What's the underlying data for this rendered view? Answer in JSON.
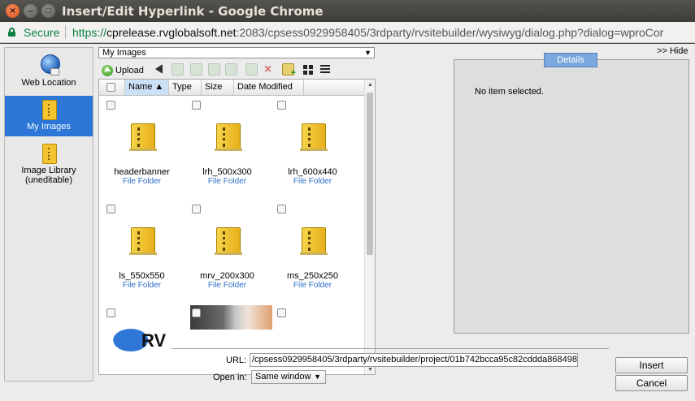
{
  "window": {
    "title": "Insert/Edit Hyperlink - Google Chrome",
    "close_symbol": "×",
    "minimize_symbol": "–",
    "maximize_symbol": "□"
  },
  "address": {
    "secure_label": "Secure",
    "scheme": "https://",
    "host": "cprelease.rvglobalsoft.net",
    "rest": ":2083/cpsess0929958405/3rdparty/rvsitebuilder/wysiwyg/dialog.php?dialog=wproCor",
    "secure_color": "#0b8043"
  },
  "nav": {
    "items": [
      {
        "label": "Web Location",
        "icon": "globe-icon",
        "active": false
      },
      {
        "label": "My Images",
        "icon": "folder-icon",
        "active": true
      },
      {
        "label": "Image Library\n(uneditable)",
        "icon": "folder-icon",
        "active": false
      }
    ],
    "active_color": "#2b76d6"
  },
  "folder_select": {
    "value": "My Images",
    "arrow": "▼"
  },
  "toolbar": {
    "upload_label": "Upload"
  },
  "columns": {
    "name": "Name ▲",
    "type": "Type",
    "size": "Size",
    "date": "Date Modified"
  },
  "files": [
    {
      "name": "headerbanner",
      "type": "File Folder"
    },
    {
      "name": "lrh_500x300",
      "type": "File Folder"
    },
    {
      "name": "lrh_600x440",
      "type": "File Folder"
    },
    {
      "name": "ls_550x550",
      "type": "File Folder"
    },
    {
      "name": "mrv_200x300",
      "type": "File Folder"
    },
    {
      "name": "ms_250x250",
      "type": "File Folder"
    }
  ],
  "partial_thumb_text": "RV",
  "scrollbar": {
    "up": "▲",
    "down": "▼"
  },
  "details": {
    "hide_label": ">> Hide",
    "tab_label": "Details",
    "empty_text": "No item selected."
  },
  "link": {
    "url_label": "URL:",
    "url_value": "/cpsess0929958405/3rdparty/rvsitebuilder/project/01b742bcca95c82cddda868498",
    "open_label": "Open in:",
    "open_value": "Same window",
    "open_arrow": "▼"
  },
  "buttons": {
    "insert": "Insert",
    "cancel": "Cancel"
  }
}
